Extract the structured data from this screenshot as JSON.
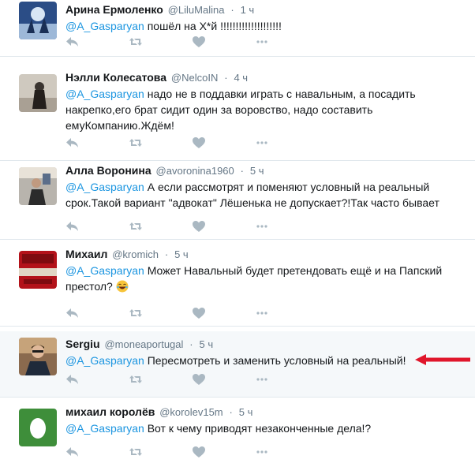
{
  "tweets": [
    {
      "fullname": "Арина Ермоленко",
      "username": "@LiluMalina",
      "separator": "·",
      "time": "1 ч",
      "mention": "@A_Gasparyan",
      "text": " пошёл на Х*й !!!!!!!!!!!!!!!!!!!!"
    },
    {
      "fullname": "Нэлли Колесатова",
      "username": "@NelcoIN",
      "separator": "·",
      "time": "4 ч",
      "mention": "@A_Gasparyan",
      "text": " надо не в поддавки играть с навальным, а посадить накрепко,его брат сидит один за воровство, надо составить емуКомпанию.Ждём!"
    },
    {
      "fullname": "Алла Воронина",
      "username": "@avoronina1960",
      "separator": "·",
      "time": "5 ч",
      "mention": "@A_Gasparyan",
      "text": " А если рассмотрят и поменяют  условный на реальный срок.Такой вариант \"адвокат\" Лёшенька не  допускает?!Так часто бывает"
    },
    {
      "fullname": "Михаил",
      "username": "@kromich",
      "separator": "·",
      "time": "5 ч",
      "mention": "@A_Gasparyan",
      "text": " Может Навальный будет претендовать ещё и на Папский престол?"
    },
    {
      "fullname": "Sergiu",
      "username": "@moneaportugal",
      "separator": "·",
      "time": "5 ч",
      "mention": "@A_Gasparyan",
      "text": " Пересмотреть и заменить условный на реальный!"
    },
    {
      "fullname": "михаил королёв",
      "username": "@korolev15m",
      "separator": "·",
      "time": "5 ч",
      "mention": "@A_Gasparyan",
      "text": " Вот к чему приводят незаконченные дела!?"
    }
  ],
  "icons": {
    "reply": "reply-icon",
    "retweet": "retweet-icon",
    "like": "heart-icon",
    "more": "more-icon",
    "annotation": "red-arrow-icon",
    "emoji": "laughing-emoji-icon"
  },
  "colors": {
    "link": "#1b95e0",
    "secondary": "#657786",
    "action": "#aab8c2",
    "annotation": "#e0162b"
  }
}
